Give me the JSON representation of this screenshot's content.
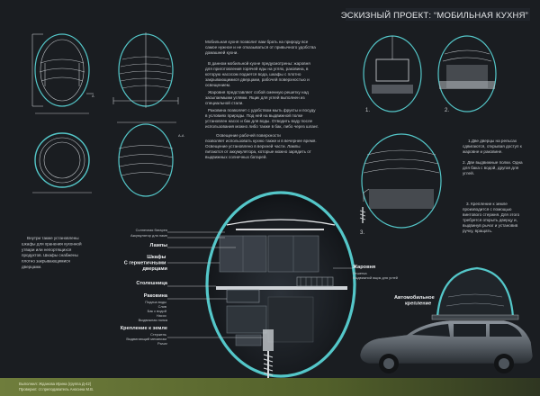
{
  "header": {
    "title": "ЭСКИЗНЫЙ ПРОЕКТ: “МОБИЛЬНАЯ КУХНЯ”"
  },
  "drawings": {
    "section_mark_a": "A",
    "section_mark_aa": "A-A"
  },
  "intro": {
    "paragraphs": [
      [
        "Мобильная кухня позволит вам брать на природу все",
        "самое нужное и не отказываться от привычного удобства",
        "домашней кухни."
      ],
      [
        "В данном мобильной кухне предусмотрены: жаровня",
        "для приготовления горячей еды на углях, раковина, в",
        "которую насосом подается вода, шкафы с плотно",
        "закрывающимися дверцами, рабочей поверхностью и",
        "освещением."
      ],
      [
        "Жаровня представляет собой сменную решетку над",
        "засыпаемыми углями. Ящик для углей выполнен из",
        "специальной стали."
      ],
      [
        "Раковина позволяет с удобством мыть фрукты и посуду",
        "в условиях природы. Под ней на выдвижной полке",
        "установлен насос и бак для воды. Отводить воду после",
        "использования можно либо также в бак, либо через шланг."
      ],
      [
        "Освещение рабочей поверхности",
        "позволяет использовать кухню также и в вечернее время.",
        "Освещение установлено в верхней части. Лампы",
        "питаются от аккумулятора, которые можно зарядить от",
        "выдвижных солнечных батарей."
      ]
    ]
  },
  "steps": {
    "labels": [
      "1.",
      "2.",
      "3."
    ],
    "notes": [
      [
        "1.Две дверцы на рельсах",
        "сдвигаются, открывая доступ к",
        "жаровне и раковине."
      ],
      [
        "2. Две выдвижные полки. Одна",
        "для бака с водой, другая для",
        "углей."
      ],
      [
        "3. Крепление к земле",
        "производится с помощью",
        "винтового стержня. Для этого",
        "требуется открыть дверцу и,",
        "выдвинув рычаг и установив",
        "ручку, вращать."
      ]
    ]
  },
  "side_note": [
    "Внутри также установлены",
    "шкафы для хранения кухонной",
    "утвари или непортящихся",
    "продуктов. Шкафы снабжены",
    "плотно закрывающимися",
    "дверцами."
  ],
  "callouts_left": {
    "battery": "Солнечная батарея",
    "accumulator": "Аккумулятор для ламп",
    "lamps": "Лампы",
    "cabinets": [
      "Шкафы",
      "С герметичными",
      "дверцами"
    ],
    "worktop": "Столешница",
    "sink": "Раковина",
    "sink_sub": [
      "Подача воды",
      "Слив",
      "Бак с водой",
      "Насос",
      "Выдвижная полка"
    ],
    "ground": "Крепление к земле",
    "ground_sub": [
      "Стержень",
      "Выдвигающий механизм",
      "Рычаг"
    ]
  },
  "callouts_right": {
    "grill": "Жаровня",
    "grill_sub": [
      "Решетка",
      "Выдвижной ящик для углей"
    ],
    "car_mount": [
      "Автомобильное",
      "крепление"
    ]
  },
  "footer": {
    "line1": "Выполнил: Жданова Ирина  (группа Д-42)",
    "line2": "Проверил: ст.преподаватель Аносина М.В."
  }
}
